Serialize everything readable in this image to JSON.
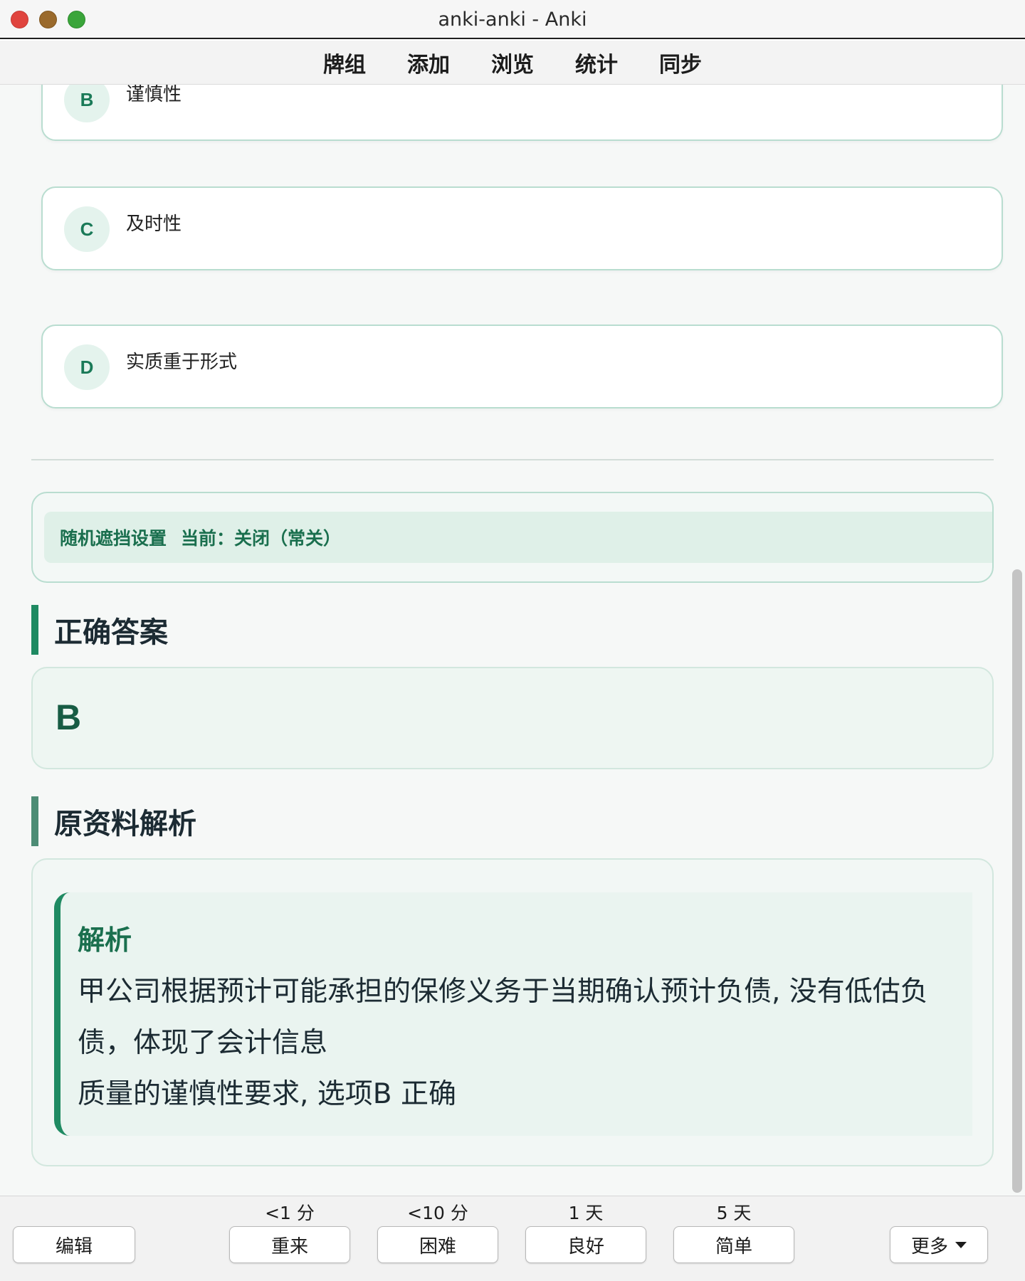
{
  "window": {
    "title": "anki-anki - Anki"
  },
  "top_menu": {
    "items": [
      "牌组",
      "添加",
      "浏览",
      "统计",
      "同步"
    ]
  },
  "options": [
    {
      "letter": "B",
      "text": "谨慎性"
    },
    {
      "letter": "C",
      "text": "及时性"
    },
    {
      "letter": "D",
      "text": "实质重于形式"
    }
  ],
  "mask_settings": {
    "title": "随机遮挡设置",
    "status": "当前：关闭（常关）"
  },
  "correct_answer": {
    "heading": "正确答案",
    "value": "B"
  },
  "analysis": {
    "heading": "原资料解析",
    "title": "解析",
    "line1": "甲公司根据预计可能承担的保修义务于当期确认预计负债, 没有低估负债，体现了会计信息",
    "line2": "质量的谨慎性要求, 选项B 正确"
  },
  "bottom_bar": {
    "edit_label": "编辑",
    "more_label": "更多",
    "answers": [
      {
        "interval": "<1 分",
        "label": "重来"
      },
      {
        "interval": "<10 分",
        "label": "困难"
      },
      {
        "interval": "1 天",
        "label": "良好"
      },
      {
        "interval": "5 天",
        "label": "简单"
      }
    ]
  },
  "colors": {
    "accent": "#1f8a62",
    "badge_bg": "#e4f3ed",
    "border": "#b9ddd0"
  }
}
